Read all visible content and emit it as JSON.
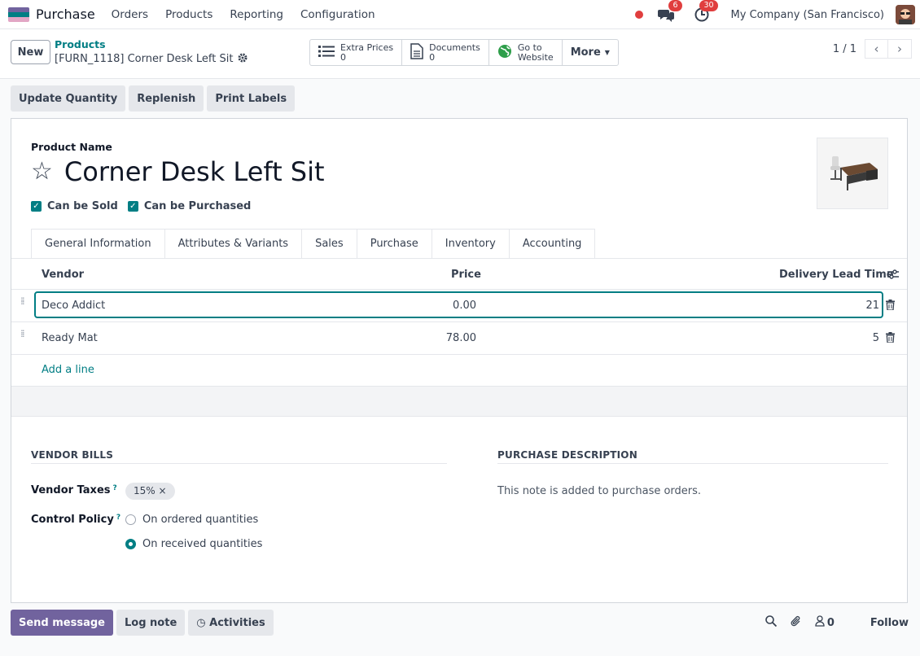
{
  "navbar": {
    "app_name": "Purchase",
    "menu": [
      "Orders",
      "Products",
      "Reporting",
      "Configuration"
    ],
    "messages_count": "6",
    "activities_count": "30",
    "company": "My Company (San Francisco)"
  },
  "control": {
    "new_label": "New",
    "breadcrumb_parent": "Products",
    "breadcrumb_current": "[FURN_1118] Corner Desk Left Sit",
    "smart_buttons": [
      {
        "line1": "Extra Prices",
        "line2": "0"
      },
      {
        "line1": "Documents",
        "line2": "0"
      },
      {
        "line1": "Go to",
        "line2": "Website"
      }
    ],
    "more_label": "More",
    "pager": "1 / 1"
  },
  "actions": [
    "Update Quantity",
    "Replenish",
    "Print Labels"
  ],
  "form": {
    "product_name_label": "Product Name",
    "product_name": "Corner Desk Left Sit",
    "can_be_sold": "Can be Sold",
    "can_be_purchased": "Can be Purchased",
    "tabs": [
      "General Information",
      "Attributes & Variants",
      "Sales",
      "Purchase",
      "Inventory",
      "Accounting"
    ],
    "active_tab": "Purchase"
  },
  "vendors_table": {
    "headers": {
      "vendor": "Vendor",
      "price": "Price",
      "lead_time": "Delivery Lead Time"
    },
    "rows": [
      {
        "vendor": "Deco Addict",
        "price": "0.00",
        "lead_time": "21"
      },
      {
        "vendor": "Ready Mat",
        "price": "78.00",
        "lead_time": "5"
      }
    ],
    "add_line": "Add a line"
  },
  "vendor_bills": {
    "title": "VENDOR BILLS",
    "taxes_label": "Vendor Taxes",
    "taxes_help": "?",
    "tax_tag": "15% ×",
    "control_policy_label": "Control Policy",
    "control_policy_help": "?",
    "options": [
      "On ordered quantities",
      "On received quantities"
    ],
    "selected_option": "On received quantities"
  },
  "purchase_description": {
    "title": "PURCHASE DESCRIPTION",
    "placeholder": "This note is added to purchase orders."
  },
  "chatter": {
    "send_message": "Send message",
    "log_note": "Log note",
    "activities": "Activities",
    "followers_count": "0",
    "follow": "Follow"
  },
  "colors": {
    "brand": "#71639e",
    "accent": "#017e84",
    "danger": "#e03e3e"
  }
}
